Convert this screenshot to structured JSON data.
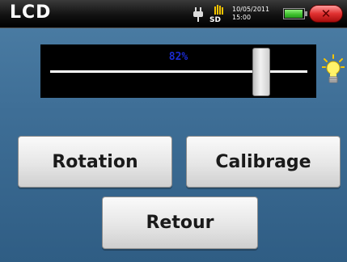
{
  "window": {
    "title": "LCD"
  },
  "status": {
    "sd_label": "SD",
    "date": "10/05/2011",
    "time": "15:00",
    "battery_level": 0.95
  },
  "brightness": {
    "value_text": "82%",
    "value": 82
  },
  "buttons": {
    "rotation": "Rotation",
    "calibrage": "Calibrage",
    "retour": "Retour"
  },
  "colors": {
    "background": "#3f6f97",
    "titlebar": "#000000",
    "slider_text": "#1a2ad0",
    "close_button": "#e03030",
    "battery": "#3cc02b"
  },
  "icons": {
    "power": "plug-icon",
    "storage": "sd-card-icon",
    "battery": "battery-icon",
    "close": "close-icon",
    "brightness": "bulb-icon"
  }
}
